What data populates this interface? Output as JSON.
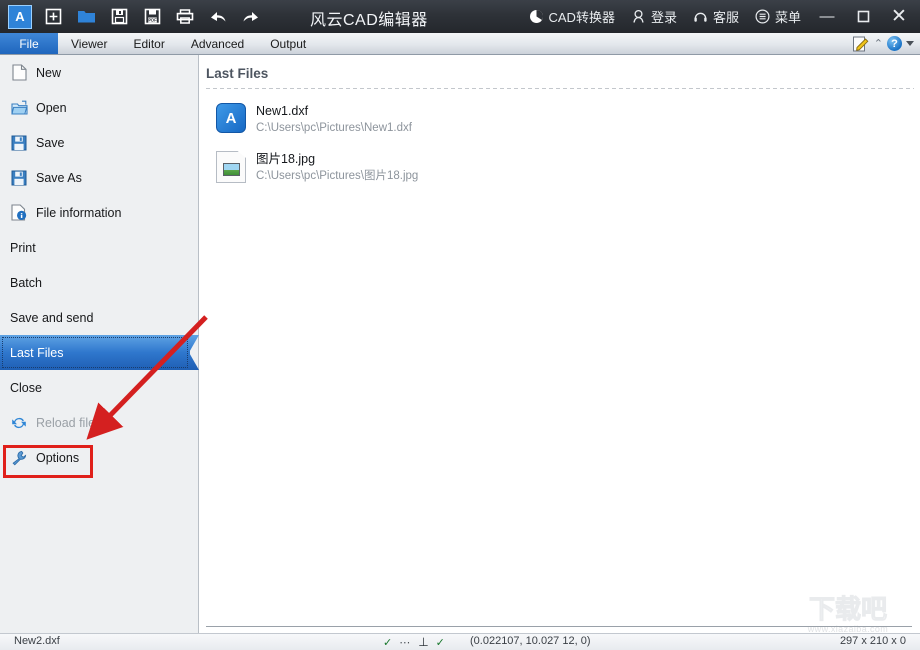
{
  "titlebar": {
    "app_title": "风云CAD编辑器",
    "logo_text": "A",
    "toolbar": [
      {
        "name": "new-file-icon",
        "glyph": "⊞"
      },
      {
        "name": "open-folder-icon",
        "glyph": "▰"
      },
      {
        "name": "save-icon",
        "glyph": "ὋE"
      },
      {
        "name": "save-pdf-icon",
        "glyph": "PDF"
      },
      {
        "name": "print-icon",
        "glyph": "⎙"
      },
      {
        "name": "undo-icon",
        "glyph": "⬅"
      },
      {
        "name": "redo-icon",
        "glyph": "➡"
      }
    ],
    "actions": [
      {
        "name": "cad-converter",
        "label": "CAD转换器",
        "icon": "circle-icon"
      },
      {
        "name": "login",
        "label": "登录",
        "icon": "user-icon"
      },
      {
        "name": "support",
        "label": "客服",
        "icon": "headset-icon"
      },
      {
        "name": "menu",
        "label": "菜单",
        "icon": "list-icon"
      }
    ],
    "window_controls": {
      "minimize": "—",
      "maximize": "☐",
      "close": "✕"
    }
  },
  "ribbon": {
    "tabs": [
      {
        "label": "File",
        "active": true
      },
      {
        "label": "Viewer",
        "active": false
      },
      {
        "label": "Editor",
        "active": false
      },
      {
        "label": "Advanced",
        "active": false
      },
      {
        "label": "Output",
        "active": false
      }
    ],
    "help_glyph": "?",
    "chevron_up": "⌃"
  },
  "sidebar": {
    "items": [
      {
        "label": "New",
        "icon": "new-document-icon",
        "state": "normal"
      },
      {
        "label": "Open",
        "icon": "open-folder-icon",
        "state": "normal"
      },
      {
        "label": "Save",
        "icon": "floppy-icon",
        "state": "normal"
      },
      {
        "label": "Save As",
        "icon": "floppy-icon",
        "state": "normal"
      },
      {
        "label": "File information",
        "icon": "info-file-icon",
        "state": "normal"
      },
      {
        "label": "Print",
        "icon": "",
        "state": "normal"
      },
      {
        "label": "Batch",
        "icon": "",
        "state": "normal"
      },
      {
        "label": "Save and send",
        "icon": "",
        "state": "normal"
      },
      {
        "label": "Last Files",
        "icon": "",
        "state": "selected"
      },
      {
        "label": "Close",
        "icon": "",
        "state": "normal"
      },
      {
        "label": "Reload file",
        "icon": "reload-icon",
        "state": "disabled"
      },
      {
        "label": "Options",
        "icon": "wrench-icon",
        "state": "highlighted"
      }
    ]
  },
  "main": {
    "header": "Last Files",
    "files": [
      {
        "name": "New1.dxf",
        "path": "C:\\Users\\pc\\Pictures\\New1.dxf",
        "icon": "dxf-file-icon",
        "icon_letter": "A"
      },
      {
        "name": "图片18.jpg",
        "path": "C:\\Users\\pc\\Pictures\\图片18.jpg",
        "icon": "image-file-icon",
        "icon_letter": ""
      }
    ]
  },
  "statusbar": {
    "filename": "New2.dxf",
    "coordinates": "(0.022107, 10.027 12, 0)",
    "dimensions": "297 x 210 x 0",
    "snap_icons": [
      "snap-vertex-icon",
      "snap-dots-icon",
      "snap-perpendicular-icon",
      "snap-endpoint-icon"
    ]
  },
  "annotations": {
    "arrow_color": "#d42020",
    "box_color": "#e0201b",
    "arrow_target": "Options",
    "highlight_target": "Options"
  },
  "watermark": {
    "text": "下载吧",
    "url": "www.xiazaiba.com"
  }
}
